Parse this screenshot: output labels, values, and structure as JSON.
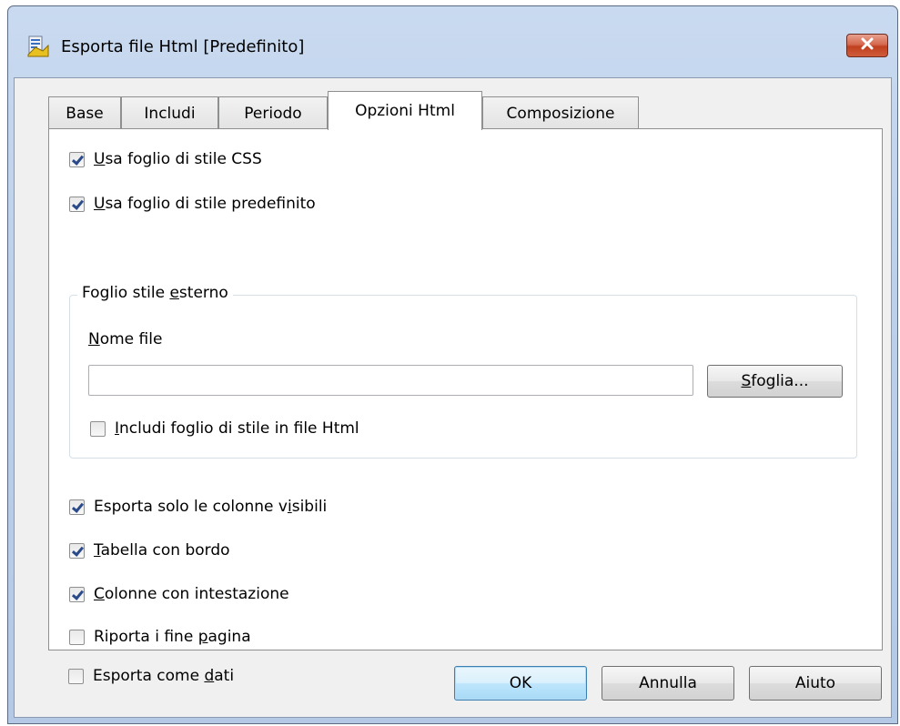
{
  "window": {
    "title": "Esporta file Html [Predefinito]"
  },
  "tabs": [
    {
      "label": "Base"
    },
    {
      "label": "Includi"
    },
    {
      "label": "Periodo"
    },
    {
      "label": "Opzioni Html",
      "active": true
    },
    {
      "label": "Composizione"
    }
  ],
  "options": {
    "use_css": {
      "label_ul": "U",
      "label_rest": "sa foglio di stile CSS",
      "checked": true
    },
    "use_default": {
      "label_ul": "U",
      "label_rest": "sa foglio di stile predefinito",
      "checked": true
    }
  },
  "external": {
    "legend_pre": "Foglio stile ",
    "legend_ul": "e",
    "legend_post": "sterno",
    "filename_label_ul": "N",
    "filename_label_rest": "ome file",
    "filename_value": "",
    "browse_ul": "S",
    "browse_rest": "foglia...",
    "include_ul": "I",
    "include_rest": "ncludi foglio di stile in file Html",
    "include_checked": false
  },
  "more_options": {
    "visible_cols": {
      "pre": "Esporta solo le colonne v",
      "ul": "i",
      "post": "sibili",
      "checked": true
    },
    "border": {
      "pre": "",
      "ul": "T",
      "post": "abella con bordo",
      "checked": true
    },
    "headers": {
      "pre": "",
      "ul": "C",
      "post": "olonne con intestazione",
      "checked": true
    },
    "page_breaks": {
      "pre": "Riporta i fine ",
      "ul": "p",
      "post": "agina",
      "checked": false
    },
    "as_data": {
      "pre": "Esporta come ",
      "ul": "d",
      "post": "ati",
      "checked": false
    }
  },
  "buttons": {
    "ok": "OK",
    "cancel": "Annulla",
    "help": "Aiuto"
  },
  "colors": {
    "title_gradient": "#bcd0ea",
    "close_red": "#c0401f",
    "check_blue": "#2b4a8a"
  },
  "icons": {
    "app": "export-html-icon",
    "close": "close-icon"
  }
}
